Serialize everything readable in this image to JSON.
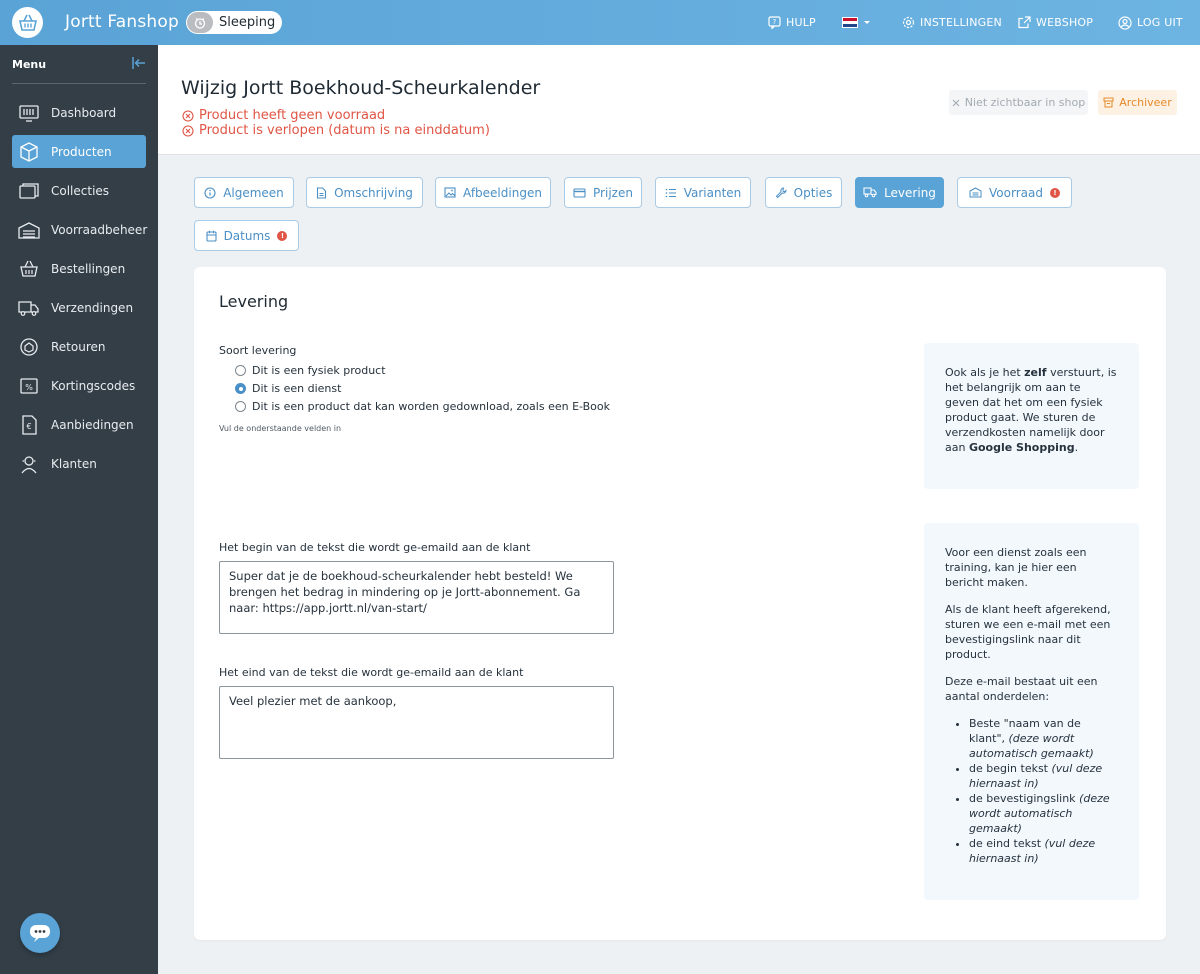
{
  "app": {
    "title": "Jortt Fanshop",
    "status": "Sleeping"
  },
  "topnav": {
    "help": "HULP",
    "settings": "INSTELLINGEN",
    "webshop": "WEBSHOP",
    "logout": "LOG UIT"
  },
  "sidebar": {
    "heading": "Menu",
    "items": [
      {
        "label": "Dashboard",
        "icon": "dashboard-icon"
      },
      {
        "label": "Producten",
        "icon": "box-icon"
      },
      {
        "label": "Collecties",
        "icon": "folder-icon"
      },
      {
        "label": "Voorraadbeheer",
        "icon": "warehouse-icon"
      },
      {
        "label": "Bestellingen",
        "icon": "basket-icon"
      },
      {
        "label": "Verzendingen",
        "icon": "truck-icon"
      },
      {
        "label": "Retouren",
        "icon": "return-icon"
      },
      {
        "label": "Kortingscodes",
        "icon": "discount-icon"
      },
      {
        "label": "Aanbiedingen",
        "icon": "offer-icon"
      },
      {
        "label": "Klanten",
        "icon": "customer-icon"
      }
    ]
  },
  "header": {
    "title": "Wijzig Jortt Boekhoud-Scheurkalender",
    "warnings": [
      "Product heeft geen voorraad",
      "Product is verlopen (datum is na einddatum)"
    ],
    "not_visible_label": "Niet zichtbaar in shop",
    "archive_label": "Archiveer"
  },
  "tabs": [
    {
      "label": "Algemeen"
    },
    {
      "label": "Omschrijving"
    },
    {
      "label": "Afbeeldingen"
    },
    {
      "label": "Prijzen"
    },
    {
      "label": "Varianten"
    },
    {
      "label": "Opties"
    },
    {
      "label": "Levering"
    },
    {
      "label": "Voorraad"
    },
    {
      "label": "Datums"
    }
  ],
  "card": {
    "title": "Levering",
    "delivery_label": "Soort levering",
    "options": [
      "Dit is een fysiek product",
      "Dit is een dienst",
      "Dit is een product dat kan worden gedownload, zoals een E-Book"
    ],
    "hint": "Vul de onderstaande velden in",
    "begin_label": "Het begin van de tekst die wordt ge-emaild aan de klant",
    "begin_value": "Super dat je de boekhoud-scheurkalender hebt besteld! We brengen het bedrag in mindering op je Jortt-abonnement. Ga naar: https://app.jortt.nl/van-start/",
    "end_label": "Het eind van de tekst die wordt ge-emaild aan de klant",
    "end_value": "Veel plezier met de aankoop,"
  },
  "info1": {
    "t1": "Ook als je het ",
    "b1": "zelf",
    "t2": " verstuurt, is het belangrijk om aan te geven dat het om een fysiek product gaat. We sturen de verzendkosten namelijk door aan ",
    "b2": "Google Shopping",
    "t3": "."
  },
  "info2": {
    "p1": "Voor een dienst zoals een training, kan je hier een bericht maken.",
    "p2": "Als de klant heeft afgerekend, sturen we een e-mail met een bevestigingslink naar dit product.",
    "p3": "Deze e-mail bestaat uit een aantal onderdelen:",
    "li1": "Beste \"naam van de klant\",",
    "li1i": "(deze wordt automatisch gemaakt)",
    "li2": "de begin tekst",
    "li2i": "(vul deze hiernaast in)",
    "li3": "de bevestigingslink",
    "li3i": "(deze wordt automatisch gemaakt)",
    "li4": "de eind tekst",
    "li4i": "(vul deze hiernaast in)"
  }
}
